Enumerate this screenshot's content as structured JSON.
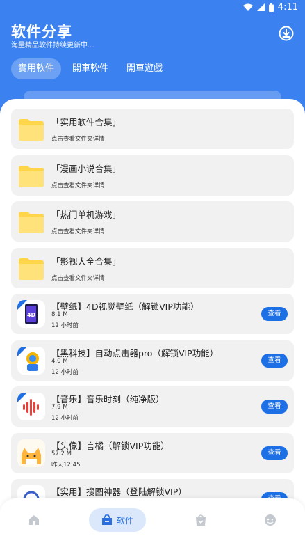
{
  "status_bar": {
    "time": "4:11"
  },
  "header": {
    "title": "软件分享",
    "subtitle": "海量精品软件持续更新中...",
    "tabs": [
      {
        "label": "實用軟件",
        "active": true
      },
      {
        "label": "開車軟件",
        "active": false
      },
      {
        "label": "開車遊戲",
        "active": false
      }
    ]
  },
  "folders": [
    {
      "title": "「实用软件合集」",
      "subtitle": "点击查看文件夹详情"
    },
    {
      "title": "「漫画小说合集」",
      "subtitle": "点击查看文件夹详情"
    },
    {
      "title": "「热门单机游戏」",
      "subtitle": "点击查看文件夹详情"
    },
    {
      "title": "「影视大全合集」",
      "subtitle": "点击查看文件夹详情"
    }
  ],
  "apps": [
    {
      "title": "【壁纸】4D视觉壁纸（解锁VIP功能）",
      "size": "8.1 M",
      "time": "12 小时前",
      "button": "查看",
      "icon": "wallpaper-app-icon"
    },
    {
      "title": "【黑科技】自动点击器pro（解锁VIP功能）",
      "size": "4.0 M",
      "time": "12 小时前",
      "button": "查看",
      "icon": "auto-clicker-app-icon"
    },
    {
      "title": "【音乐】音乐时刻（纯净版）",
      "size": "7.9 M",
      "time": "12 小时前",
      "button": "查看",
      "icon": "music-app-icon"
    },
    {
      "title": "【头像】言橘（解锁VIP功能）",
      "size": "57.2 M",
      "time": "昨天12:45",
      "button": "查看",
      "icon": "avatar-app-icon"
    },
    {
      "title": "【实用】搜图神器（登陆解锁VIP）",
      "size": "",
      "time": "",
      "button": "查看",
      "icon": "image-search-app-icon"
    }
  ],
  "bottom_nav": {
    "active_label": "软件"
  },
  "colors": {
    "header_bg": "#3b82f0",
    "accent": "#1d6fe6",
    "folder": "#ffd54a"
  }
}
